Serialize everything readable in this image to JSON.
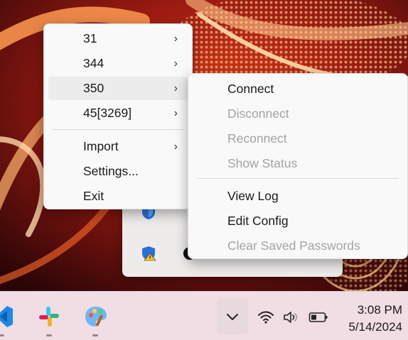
{
  "main_menu": {
    "items": [
      {
        "label": "31",
        "submenu": true
      },
      {
        "label": "344",
        "submenu": true
      },
      {
        "label": "350",
        "submenu": true,
        "highlighted": true
      },
      {
        "label": "45[3269]",
        "submenu": true
      },
      {
        "label": "Import",
        "submenu": true
      },
      {
        "label": "Settings..."
      },
      {
        "label": "Exit"
      }
    ]
  },
  "sub_menu": {
    "items": [
      {
        "label": "Connect",
        "enabled": true
      },
      {
        "label": "Disconnect",
        "enabled": false
      },
      {
        "label": "Reconnect",
        "enabled": false
      },
      {
        "label": "Show Status",
        "enabled": false
      },
      {
        "label": "View Log",
        "enabled": true
      },
      {
        "label": "Edit Config",
        "enabled": true
      },
      {
        "label": "Clear Saved Passwords",
        "enabled": false
      }
    ]
  },
  "taskbar": {
    "pinned_apps": [
      "vscode-icon",
      "slack-icon",
      "paint-icon"
    ],
    "tray_icons": [
      "wifi-icon",
      "volume-icon",
      "battery-icon"
    ]
  },
  "clock": {
    "time": "3:08 PM",
    "date": "5/14/2024"
  }
}
